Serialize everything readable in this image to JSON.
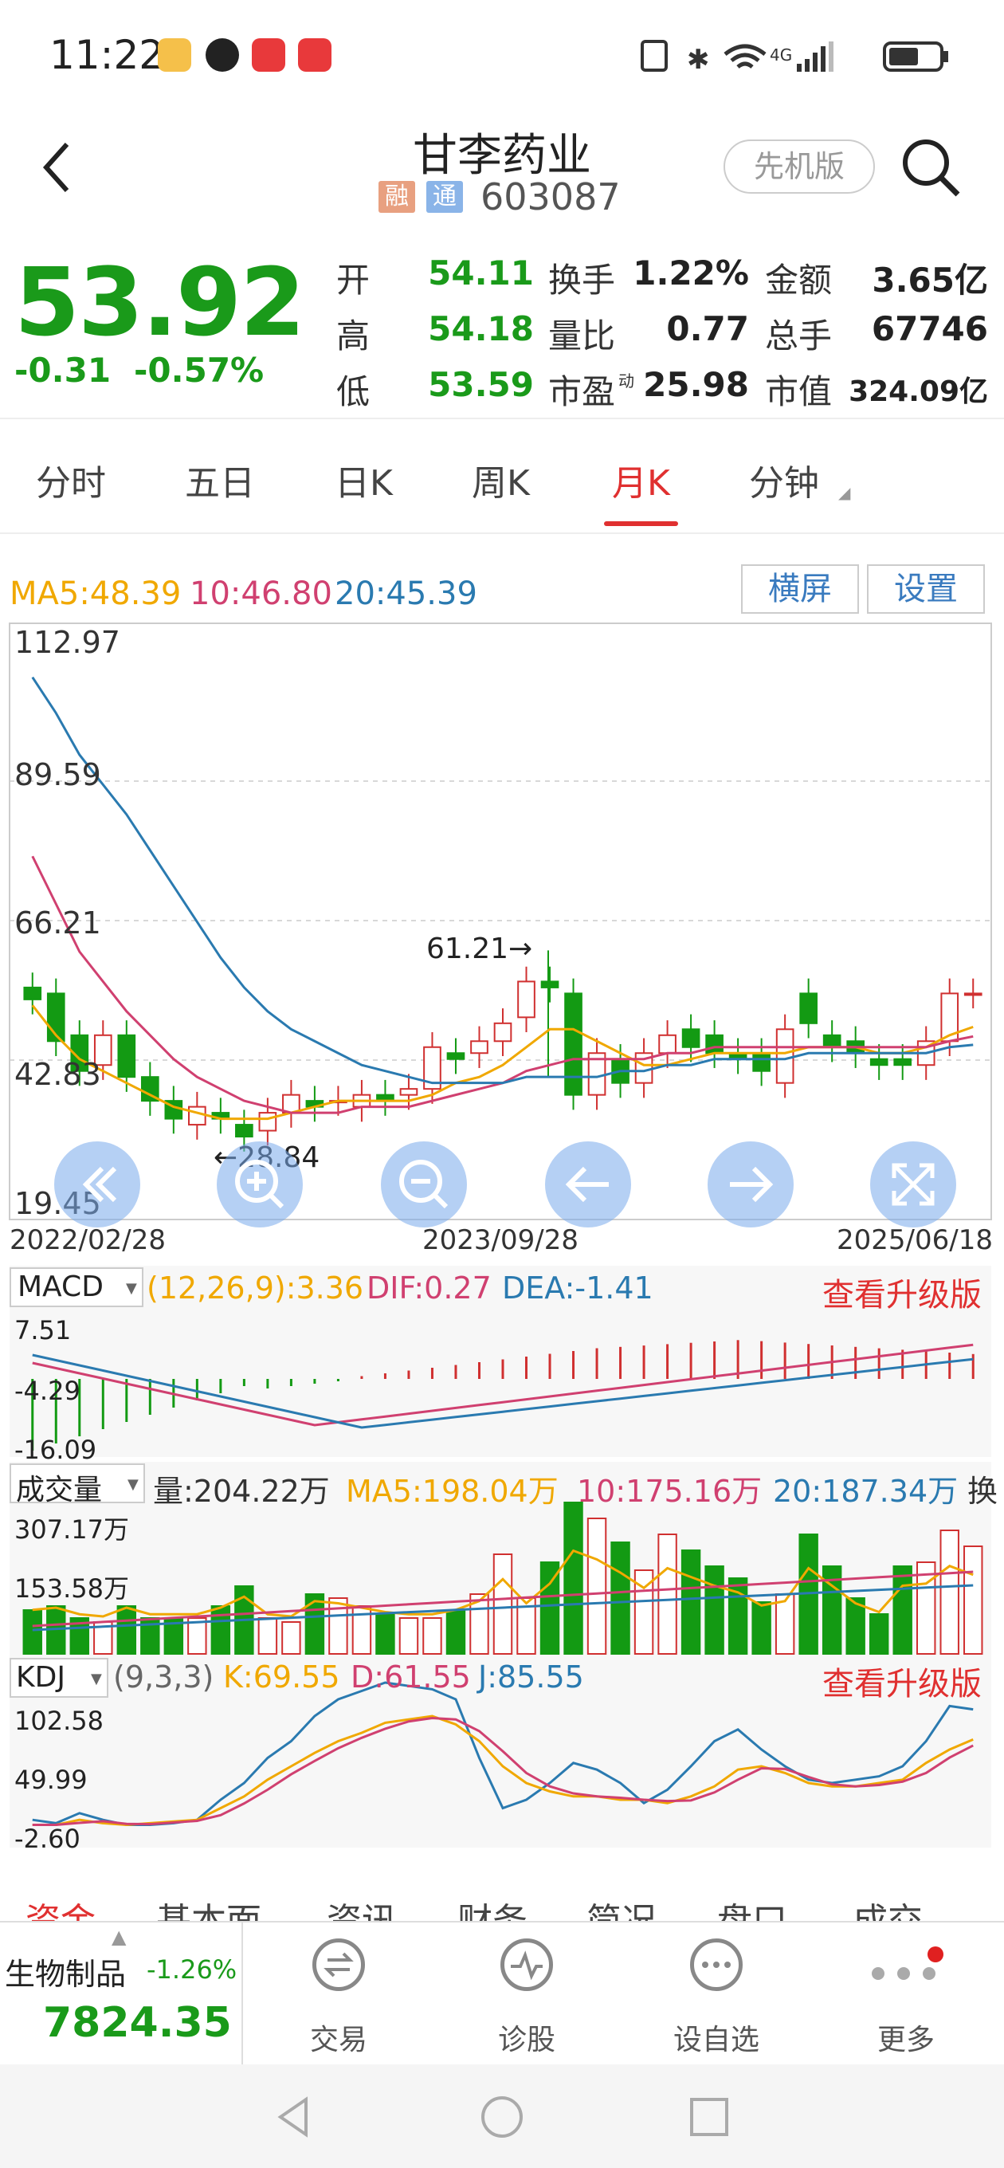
{
  "status": {
    "time": "11:22",
    "battery_icon": "battery-icon",
    "signal_label": "4G"
  },
  "header": {
    "title": "甘李药业",
    "tag1": "融",
    "tag2": "通",
    "code": "603087",
    "old_version": "先机版"
  },
  "quote": {
    "price": "53.92",
    "change": "-0.31",
    "change_pct": "-0.57%",
    "rows": [
      {
        "l1": "开",
        "v1": "54.11",
        "l2": "换手",
        "v2": "1.22%",
        "l3": "金额",
        "v3": "3.65亿"
      },
      {
        "l1": "高",
        "v1": "54.18",
        "l2": "量比",
        "v2": "0.77",
        "l3": "总手",
        "v3": "67746"
      },
      {
        "l1": "低",
        "v1": "53.59",
        "l2": "市盈",
        "l2sup": "动",
        "v2": "25.98",
        "l3": "市值",
        "v3": "324.09亿"
      }
    ]
  },
  "tabs": [
    "分时",
    "五日",
    "日K",
    "周K",
    "月K",
    "分钟"
  ],
  "ma": {
    "ma5": "MA5:48.39",
    "ma10": "10:46.80",
    "ma20": "20:45.39",
    "landscape": "横屏",
    "settings": "设置"
  },
  "kline": {
    "y_labels": [
      "112.97",
      "89.59",
      "66.21",
      "42.83",
      "19.45"
    ],
    "x_labels": [
      "2022/02/28",
      "2023/09/28",
      "2025/06/18"
    ],
    "high_mark": "61.21→",
    "low_mark": "←28.84"
  },
  "macd": {
    "name": "MACD",
    "params": "(12,26,9):3.36",
    "dif": "DIF:0.27",
    "dea": "DEA:-1.41",
    "upgrade": "查看升级版",
    "y_labels": [
      "7.51",
      "-4.29",
      "-16.09"
    ]
  },
  "volume": {
    "name": "成交量",
    "vol": "量:204.22万",
    "ma5": "MA5:198.04万",
    "ma10": "10:175.16万",
    "ma20": "20:187.34万",
    "more": "换",
    "y_labels": [
      "307.17万",
      "153.58万"
    ]
  },
  "kdj": {
    "name": "KDJ",
    "params": "(9,3,3)",
    "k": "K:69.55",
    "d": "D:61.55",
    "j": "J:85.55",
    "upgrade": "查看升级版",
    "y_labels": [
      "102.58",
      "49.99",
      "-2.60"
    ]
  },
  "tabs2": [
    "资金",
    "基本面",
    "资讯",
    "财务",
    "简况",
    "盘口",
    "成交"
  ],
  "bottom": {
    "sector_name": "生物制品",
    "sector_pct": "-1.26%",
    "sector_value": "7824.35",
    "trade": "交易",
    "diagnose": "诊股",
    "watchlist": "设自选",
    "more": "更多"
  },
  "chart_data": {
    "type": "candlestick",
    "title": "甘李药业 月K",
    "dates_shown": [
      "2022/02/28",
      "2023/09/28",
      "2025/06/18"
    ],
    "ylim": [
      19.45,
      112.97
    ],
    "candles": [
      {
        "o": 55,
        "c": 53
      },
      {
        "o": 54,
        "c": 46
      },
      {
        "o": 47,
        "c": 41
      },
      {
        "o": 42,
        "c": 47
      },
      {
        "o": 47,
        "c": 40
      },
      {
        "o": 40,
        "c": 36
      },
      {
        "o": 36,
        "c": 33
      },
      {
        "o": 32,
        "c": 35
      },
      {
        "o": 34,
        "c": 33
      },
      {
        "o": 32,
        "c": 30
      },
      {
        "o": 31,
        "c": 34
      },
      {
        "o": 34,
        "c": 37
      },
      {
        "o": 36,
        "c": 35
      },
      {
        "o": 36,
        "c": 36
      },
      {
        "o": 35,
        "c": 37
      },
      {
        "o": 37,
        "c": 36
      },
      {
        "o": 37,
        "c": 38
      },
      {
        "o": 38,
        "c": 45
      },
      {
        "o": 44,
        "c": 43
      },
      {
        "o": 44,
        "c": 46
      },
      {
        "o": 46,
        "c": 49
      },
      {
        "o": 50,
        "c": 56
      },
      {
        "o": 56,
        "c": 55
      },
      {
        "o": 54,
        "c": 37
      },
      {
        "o": 37,
        "c": 44
      },
      {
        "o": 43,
        "c": 39
      },
      {
        "o": 39,
        "c": 44
      },
      {
        "o": 44,
        "c": 47
      },
      {
        "o": 48,
        "c": 45
      },
      {
        "o": 47,
        "c": 44
      },
      {
        "o": 44,
        "c": 43
      },
      {
        "o": 44,
        "c": 41
      },
      {
        "o": 39,
        "c": 48
      },
      {
        "o": 54,
        "c": 49
      },
      {
        "o": 47,
        "c": 45
      },
      {
        "o": 46,
        "c": 44
      },
      {
        "o": 43,
        "c": 42
      },
      {
        "o": 43,
        "c": 42
      },
      {
        "o": 42,
        "c": 46
      },
      {
        "o": 46,
        "c": 54
      },
      {
        "o": 54,
        "c": 54
      }
    ],
    "ma5": [
      52,
      47,
      43,
      41,
      39,
      37,
      35,
      34,
      33,
      33,
      33,
      34,
      35,
      36,
      36,
      36,
      36,
      37,
      39,
      40,
      42,
      45,
      48,
      48,
      46,
      44,
      42,
      42,
      43,
      44,
      44,
      44,
      44,
      45,
      45,
      45,
      44,
      44,
      45,
      47,
      48.39
    ],
    "ma10": [
      77,
      69,
      61,
      56,
      51,
      47,
      43,
      40,
      38,
      36,
      35,
      34,
      34,
      34,
      35,
      35,
      35,
      36,
      37,
      38,
      39,
      41,
      42,
      43,
      43,
      43,
      43,
      44,
      44,
      45,
      45,
      45,
      45,
      45,
      45,
      45,
      45,
      45,
      45,
      46,
      46.8
    ],
    "ma20": [
      107,
      101,
      94,
      89,
      84,
      78,
      72,
      66,
      60,
      55,
      51,
      48,
      46,
      44,
      42,
      41,
      40,
      39,
      39,
      39,
      39,
      40,
      40,
      40,
      40,
      41,
      41,
      42,
      42,
      43,
      43,
      43,
      43,
      44,
      44,
      44,
      44,
      44,
      44,
      45,
      45.39
    ]
  }
}
